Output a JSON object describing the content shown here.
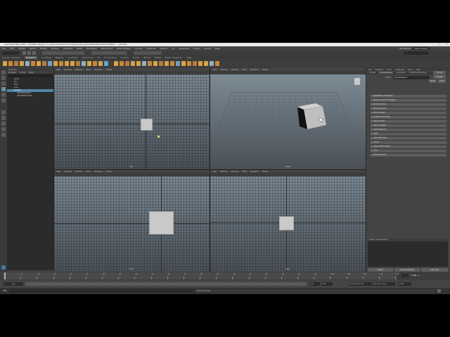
{
  "window": {
    "title": "Autodesk Maya 2017 - Student Version: C:\\Users\\user\\Documents\\maya\\projects\\default\\scenes\\untitled*  ---  pCube1",
    "controls": [
      "–",
      "□",
      "✕"
    ]
  },
  "menubar": {
    "items": [
      "File",
      "Edit",
      "Create",
      "Select",
      "Modify",
      "Display",
      "Windows",
      "Mesh",
      "Edit Mesh",
      "Mesh Tools",
      "Mesh Display",
      "Curves",
      "Surfaces",
      "Deform",
      "UV",
      "Generate",
      "Cache",
      "Arnold",
      "Help"
    ],
    "workspace_label": "Workspace:",
    "workspace_value": "Maya Classic"
  },
  "shelf": {
    "tabs": [
      "Curves / Surfaces",
      "Polygons",
      "Sculpting",
      "Rigging",
      "Animation",
      "Rendering",
      "FX",
      "FX Caching",
      "Custom",
      "Arnold",
      "Bifrost",
      "MASH",
      "Motion Graphics",
      "XGen"
    ],
    "active_tab": "Polygons"
  },
  "outliner": {
    "title": "Outliner",
    "menu": [
      "Display",
      "Show",
      "Help"
    ],
    "items": [
      {
        "label": "persp",
        "selected": false,
        "child": false
      },
      {
        "label": "top",
        "selected": false,
        "child": false
      },
      {
        "label": "front",
        "selected": false,
        "child": false
      },
      {
        "label": "side",
        "selected": false,
        "child": false
      },
      {
        "label": "pCube1",
        "selected": true,
        "child": false
      },
      {
        "label": "defaultLightSet",
        "selected": false,
        "child": true
      },
      {
        "label": "defaultObjectSet",
        "selected": false,
        "child": true
      }
    ]
  },
  "viewports": {
    "menu": [
      "View",
      "Shading",
      "Lighting",
      "Show",
      "Renderer",
      "Panels"
    ],
    "top": {
      "label": "top"
    },
    "persp": {
      "label": "persp"
    },
    "front": {
      "label": "front"
    },
    "side": {
      "label": "side"
    }
  },
  "attribute_editor": {
    "tabs": [
      "List",
      "Selected",
      "Focus",
      "Attributes",
      "Show",
      "Help"
    ],
    "node_tabs": [
      "pCube1",
      "pCubeShape1",
      "polyCube1",
      "initialShadingGroup"
    ],
    "node_label": "mesh:",
    "node_value": "pCubeShape1",
    "focus_label": "Focus",
    "presets_label": "Presets",
    "show_label": "Show",
    "hide_label": "Hide",
    "sections": [
      "Tessellation Attributes",
      "Mesh Component Display",
      "Mesh Controls",
      "Tangent Space",
      "Smooth Mesh",
      "Displacement Map",
      "Render Stats",
      "Object Display",
      "Node Behavior",
      "UUID",
      "Extra Attributes",
      "Notes: pCubeShape1",
      "Arnold",
      "Shape Deformation",
      "Color",
      "Node Behavior"
    ],
    "notes_label": "Notes: pCubeShape1",
    "buttons": {
      "select": "Select",
      "load": "Load Attributes",
      "copy": "Copy Tab"
    }
  },
  "timeline": {
    "ticks": [
      "1",
      "5",
      "10",
      "15",
      "20",
      "25",
      "30",
      "35",
      "40",
      "45",
      "50",
      "55",
      "60",
      "65",
      "70",
      "75",
      "80",
      "85",
      "90",
      "95",
      "100",
      "105",
      "110",
      "115",
      "120"
    ],
    "current": "1",
    "start": "1",
    "end": "120",
    "range_start": "1",
    "range_end": "200",
    "anim_layer": "No Anim Layer",
    "char_set": "No Character Set",
    "fps": "24 fps"
  },
  "commandline": {
    "lang": "MEL",
    "help_text": "Result: pCube1"
  },
  "colors": {
    "accent": "#5285a6",
    "shelf_icons": [
      "#d9a441",
      "#c9873a",
      "#b57c3c",
      "#d0a04c",
      "#8bb0c4",
      "#c9873a",
      "#d9a441",
      "#b57c3c",
      "#6aa0c8",
      "#d9a441",
      "#c9873a",
      "#d0a04c",
      "#d9a441",
      "#b57c3c",
      "#8bb0c4",
      "#d9a441",
      "#c9873a",
      "#d0a04c",
      "#6aa0c8",
      "#d9a441",
      "#c9873a",
      "#b57c3c",
      "#d0a04c",
      "#d9a441",
      "#8bb0c4",
      "#c9873a",
      "#d9a441",
      "#b57c3c",
      "#d0a04c",
      "#c9873a",
      "#6aa0c8",
      "#d9a441",
      "#c9873a",
      "#b57c3c",
      "#d0a04c",
      "#d9a441",
      "#8bb0c4",
      "#c9873a"
    ]
  }
}
